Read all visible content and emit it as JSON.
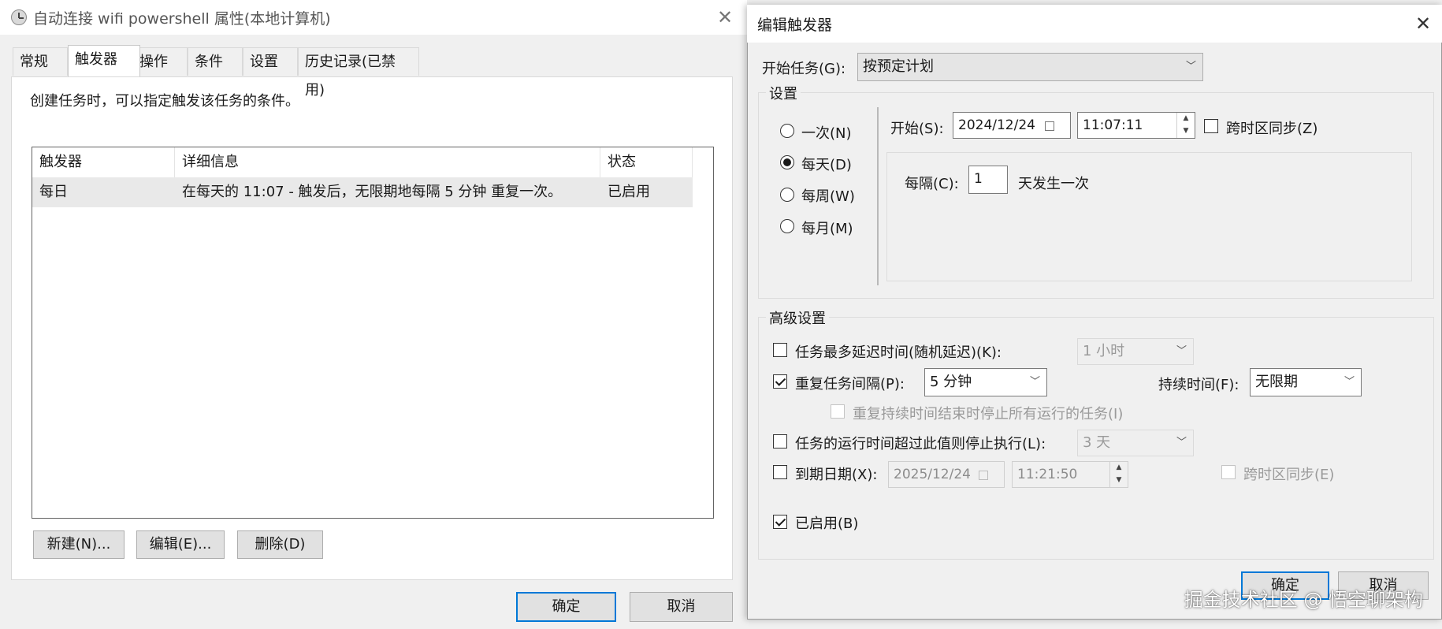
{
  "left_window": {
    "title": "自动连接 wifi powershell 属性(本地计算机)",
    "close_glyph": "✕",
    "tabs": [
      "常规",
      "触发器",
      "操作",
      "条件",
      "设置",
      "历史记录(已禁用)"
    ],
    "active_tab": "触发器",
    "description": "创建任务时，可以指定触发该任务的条件。",
    "table": {
      "headers": [
        "触发器",
        "详细信息",
        "状态"
      ],
      "rows": [
        [
          "每日",
          "在每天的 11:07 - 触发后，无限期地每隔 5 分钟 重复一次。",
          "已启用"
        ]
      ]
    },
    "buttons": {
      "new": "新建(N)...",
      "edit": "编辑(E)...",
      "delete": "删除(D)"
    },
    "ok": "确定",
    "cancel": "取消"
  },
  "right_window": {
    "title": "编辑触发器",
    "close_glyph": "✕",
    "start_task_label": "开始任务(G):",
    "start_task_value": "按预定计划",
    "settings_group": "设置",
    "radios": [
      "一次(N)",
      "每天(D)",
      "每周(W)",
      "每月(M)"
    ],
    "selected_radio": "每天(D)",
    "start_label": "开始(S):",
    "start_date": "2024/12/24",
    "start_time": "11:07:11",
    "sync_tz": "跨时区同步(Z)",
    "every_label": "每隔(C):",
    "every_value": "1",
    "every_suffix": "天发生一次",
    "advanced_group": "高级设置",
    "delay_label": "任务最多延迟时间(随机延迟)(K):",
    "delay_value": "1 小时",
    "repeat_label": "重复任务间隔(P):",
    "repeat_value": "5 分钟",
    "duration_label": "持续时间(F):",
    "duration_value": "无限期",
    "stop_all_label": "重复持续时间结束时停止所有运行的任务(I)",
    "stop_long_label": "任务的运行时间超过此值则停止执行(L):",
    "stop_long_value": "3 天",
    "expire_label": "到期日期(X):",
    "expire_date": "2025/12/24",
    "expire_time": "11:21:50",
    "expire_sync": "跨时区同步(E)",
    "enabled_label": "已启用(B)",
    "ok": "确定",
    "cancel": "取消"
  },
  "watermark": "掘金技术社区 @ 悟空聊架构"
}
